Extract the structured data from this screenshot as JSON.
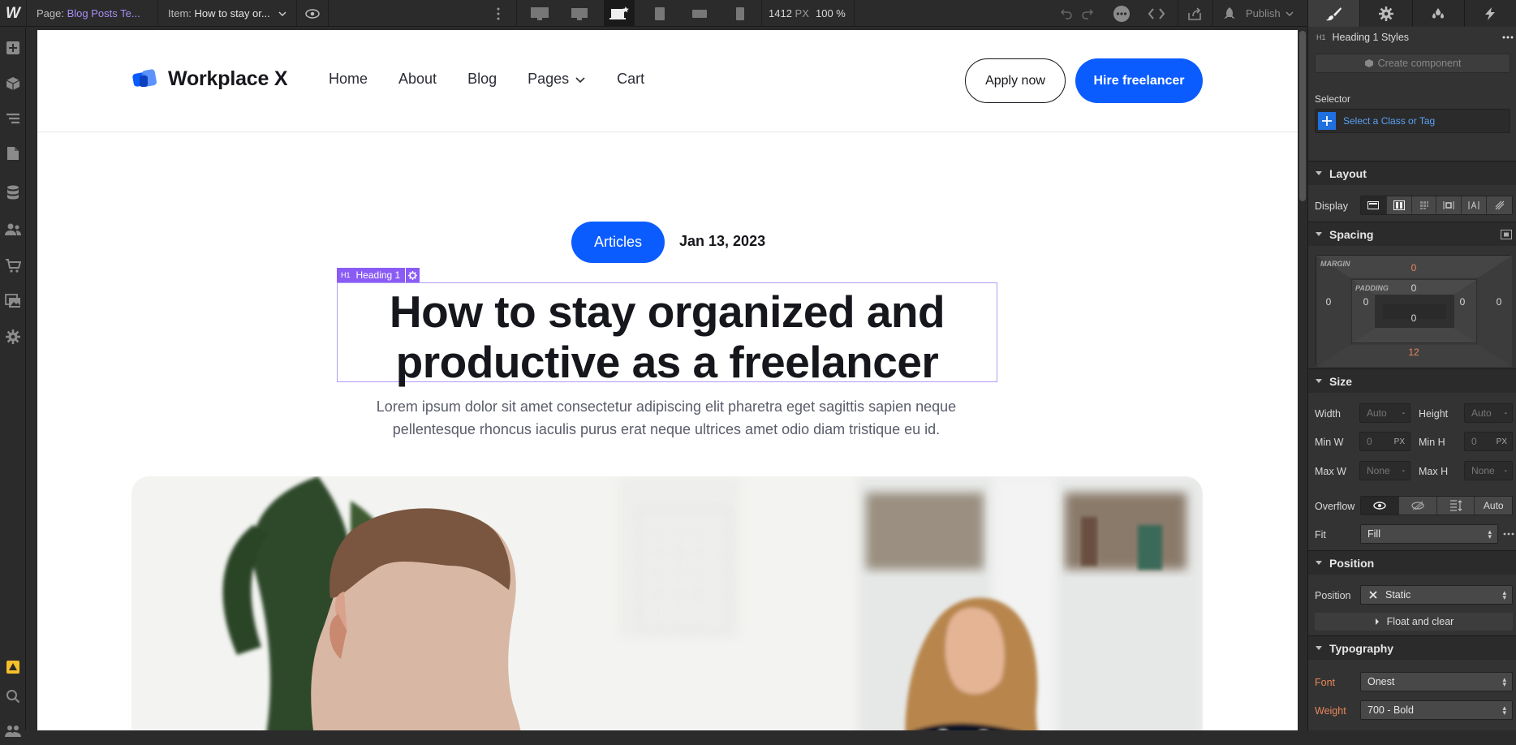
{
  "topbar": {
    "page_label": "Page:",
    "page_value": "Blog Posts Te...",
    "item_label": "Item:",
    "item_value": "How to stay or...",
    "canvas_width": "1412",
    "canvas_unit": "PX",
    "zoom": "100 %",
    "publish_label": "Publish"
  },
  "site": {
    "brand": "Workplace X",
    "nav": [
      "Home",
      "About",
      "Blog",
      "Pages",
      "Cart"
    ],
    "apply_button": "Apply now",
    "hire_button": "Hire freelancer",
    "category_pill": "Articles",
    "date": "Jan 13, 2023",
    "selection_tag": "Heading 1",
    "selection_tag_prefix": "H1",
    "heading_line1": "How to stay organized and",
    "heading_line2": "productive as a freelancer",
    "subtitle_line1": "Lorem ipsum dolor sit amet consectetur adipiscing elit pharetra eget sagittis sapien neque",
    "subtitle_line2": "pellentesque rhoncus iaculis purus erat neque ultrices amet odio diam tristique eu id."
  },
  "panel": {
    "styles_title": "Heading 1 Styles",
    "styles_prefix": "H1",
    "create_component": "Create component",
    "selector_label": "Selector",
    "selector_placeholder": "Select a Class or Tag",
    "layout": "Layout",
    "display_label": "Display",
    "spacing": "Spacing",
    "margin_caption": "MARGIN",
    "padding_caption": "PADDING",
    "margin": {
      "top": "0",
      "right": "0",
      "bottom": "12",
      "left": "0"
    },
    "padding": {
      "top": "0",
      "right": "0",
      "bottom": "0",
      "left": "0"
    },
    "size": "Size",
    "width_label": "Width",
    "width_value": "Auto",
    "height_label": "Height",
    "height_value": "Auto",
    "minw_label": "Min W",
    "minw_value": "0",
    "minh_label": "Min H",
    "minh_value": "0",
    "maxw_label": "Max W",
    "maxw_value": "None",
    "maxh_label": "Max H",
    "maxh_value": "None",
    "unit_px": "PX",
    "unit_dash": "-",
    "overflow_label": "Overflow",
    "overflow_auto": "Auto",
    "fit_label": "Fit",
    "fit_value": "Fill",
    "position": "Position",
    "position_label": "Position",
    "position_value": "Static",
    "float_clear": "Float and clear",
    "typography": "Typography",
    "font_label": "Font",
    "font_value": "Onest",
    "weight_label": "Weight",
    "weight_value": "700 - Bold"
  },
  "colors": {
    "accent_blue": "#0a5cff",
    "selection_purple": "#8a5cf5",
    "panel_bg": "#333333",
    "inherited_orange": "#e9875a"
  }
}
